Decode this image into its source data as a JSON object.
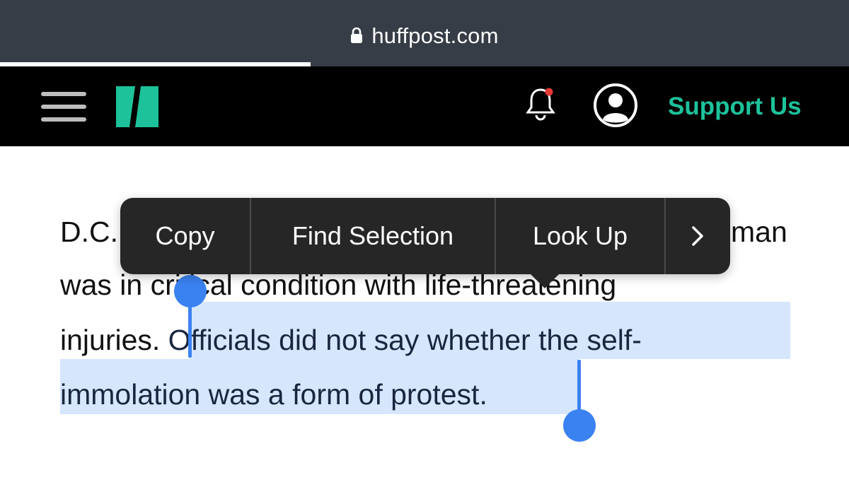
{
  "browser": {
    "url": "huffpost.com",
    "load_progress": 0.366,
    "icons": {
      "lock": "lock-icon"
    }
  },
  "site_nav": {
    "brand_color": "#1dc29a",
    "support_label": "Support Us",
    "icons": {
      "menu": "hamburger-icon",
      "logo": "huffpost-logo",
      "notifications": "bell-icon",
      "notification_dot_color": "#e53935",
      "account": "user-circle-icon"
    }
  },
  "article": {
    "line_1_start": "D.C.",
    "line_1_end": "man",
    "line_2": "was in critical condition with life-threatening",
    "line_3_unselected": "injuries. ",
    "line_3_selected": "Officials did not say whether the self-",
    "line_4_selected": "immolation was a form of protest.",
    "selection_color": "#d6e6fd",
    "handle_color": "#3b82f1"
  },
  "context_menu": {
    "items": [
      {
        "label": "Copy"
      },
      {
        "label": "Find Selection"
      },
      {
        "label": "Look Up"
      }
    ],
    "more_icon": "chevron-right-icon"
  }
}
